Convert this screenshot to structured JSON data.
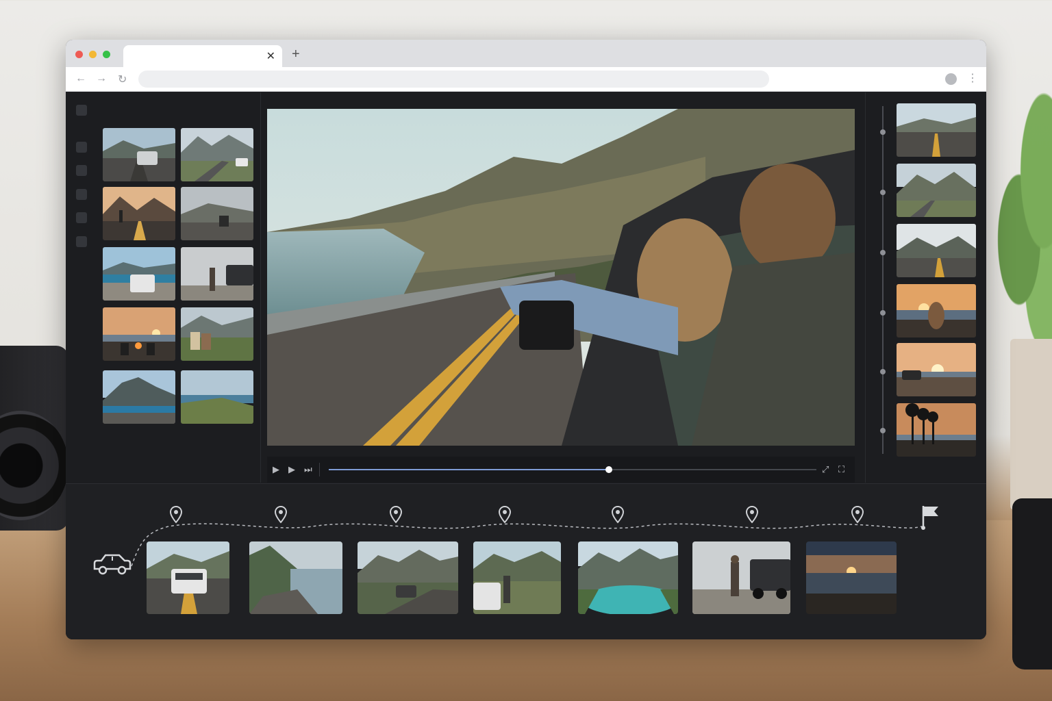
{
  "browser": {
    "tab_title": "",
    "close_icon": "close-icon",
    "new_tab_icon": "plus-icon",
    "address_value": "",
    "nav_icons": [
      "back-icon",
      "forward-icon",
      "reload-icon"
    ]
  },
  "glyphs": {
    "close": "✕",
    "plus": "+",
    "back": "←",
    "forward": "→",
    "reload": "↻",
    "menu": "⋮",
    "play": "▶",
    "step": "▶",
    "next": "⏭",
    "expand": "⤢",
    "fullscreen": "⛶"
  },
  "sidebar": {
    "icons": [
      "rail-icon-1",
      "rail-icon-2",
      "rail-icon-3",
      "rail-icon-4",
      "rail-icon-5",
      "rail-icon-6"
    ]
  },
  "library": {
    "thumbnails": [
      "car on coastal road",
      "white suv on mountain road",
      "person standing at sunset road",
      "person sitting by car",
      "white suv at lake viewpoint",
      "person next to pickup truck",
      "campfire at sunset",
      "friends sitting on hill",
      "mountain lake road",
      "grassy coastal hill"
    ]
  },
  "player": {
    "progress": 0.575,
    "controls": [
      "play-icon",
      "step-forward-icon",
      "skip-next-icon",
      "expand-icon",
      "fullscreen-icon"
    ]
  },
  "shotlist": {
    "shots": [
      "empty highway",
      "mountain valley road",
      "road toward mountains",
      "woman at sunset lake",
      "car at sunset coast",
      "palm trees at sunset"
    ]
  },
  "route": {
    "start_icon": "car-icon",
    "end_icon": "flag-icon",
    "stops": [
      "suv on coastal road",
      "coastal cliffs",
      "mountain road with car",
      "people by car at overlook",
      "turquoise mountain lake",
      "hiker by pickup truck",
      "sunset over ocean"
    ]
  },
  "colors": {
    "app_bg": "#1c1d20",
    "accent": "#7f9cd6"
  }
}
